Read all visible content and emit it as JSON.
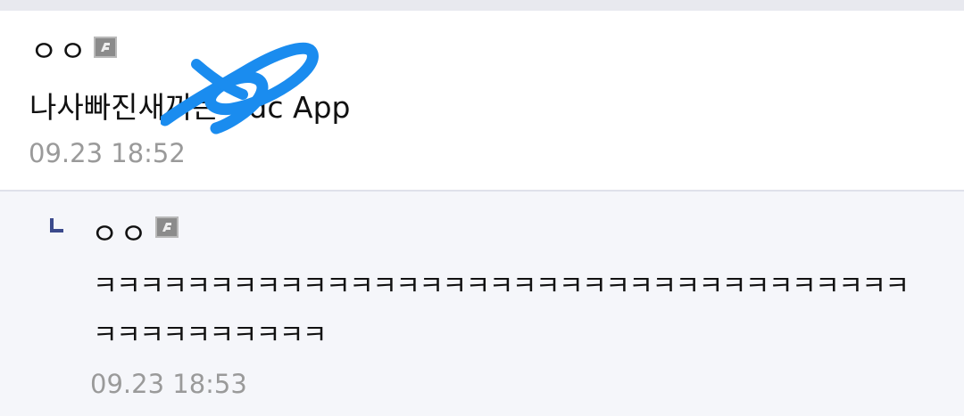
{
  "comment": {
    "nickname": "ㅇㅇ",
    "text": "나사빠진새끼는 - dc App",
    "timestamp": "09.23 18:52"
  },
  "reply": {
    "nickname": "ㅇㅇ",
    "text_line1": "ㅋㅋㅋㅋㅋㅋㅋㅋㅋㅋㅋㅋㅋㅋㅋㅋㅋㅋㅋㅋㅋㅋㅋㅋㅋㅋㅋㅋㅋㅋㅋㅋㅋㅋㅋ",
    "text_line2": "ㅋㅋㅋㅋㅋㅋㅋㅋㅋㅋ",
    "timestamp": "09.23 18:53"
  },
  "colors": {
    "scribble": "#1a8cef",
    "reply_arrow": "#3b4a8c"
  },
  "icons": {
    "badge": "fixed-nick-badge-icon",
    "reply": "reply-arrow-icon"
  }
}
